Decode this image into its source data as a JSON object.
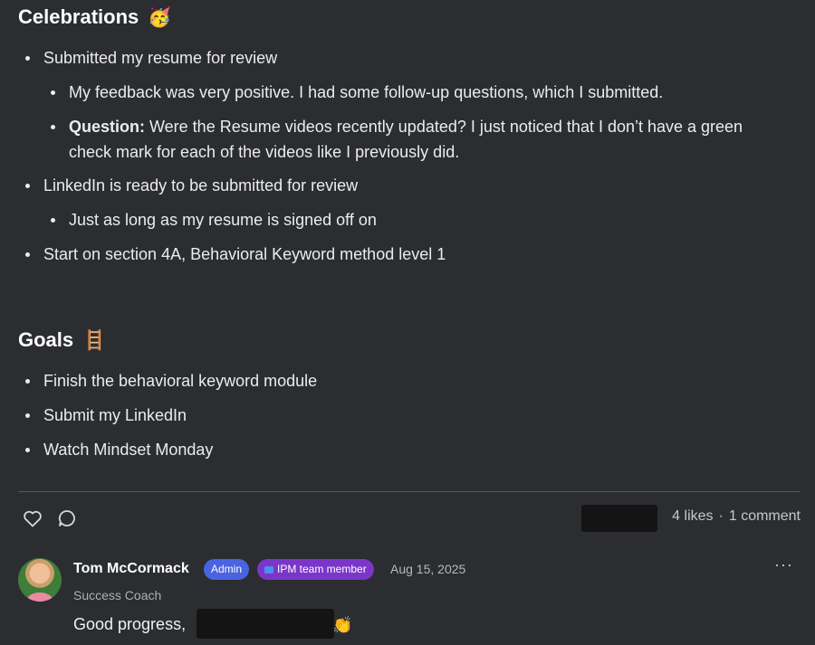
{
  "celebrations": {
    "heading": "Celebrations",
    "emoji": "🥳",
    "items": [
      {
        "text": "Submitted my resume for review"
      },
      {
        "text": "My feedback was very positive. I had some follow-up questions, which I submitted."
      },
      {
        "bold": "Question:",
        "text": " Were the Resume videos recently updated? I just noticed that I don’t have a green check mark for each of the videos like I previously did."
      },
      {
        "text": "LinkedIn is ready to be submitted for review"
      },
      {
        "text": "Just as long as my resume is signed off on"
      },
      {
        "text": "Start on section 4A, Behavioral Keyword method level 1"
      }
    ]
  },
  "goals": {
    "heading": "Goals",
    "emoji": "🪜",
    "items": [
      {
        "text": "Finish the behavioral keyword module"
      },
      {
        "text": "Submit my LinkedIn"
      },
      {
        "text": "Watch Mindset Monday"
      }
    ]
  },
  "post_actions": {
    "like_icon": "heart-icon",
    "comment_icon": "speech-bubble-icon",
    "likes": "4 likes",
    "separator": "·",
    "comments": "1 comment"
  },
  "comment": {
    "author": "Tom McCormack",
    "badge_admin": "Admin",
    "badge_team": "IPM team member",
    "date": "Aug 15, 2025",
    "role": "Success Coach",
    "text": "Good progress,",
    "emoji": "👏",
    "more_label": "···"
  },
  "colors": {
    "background": "#2b2d31",
    "admin_badge": "#4a63e0",
    "team_badge": "#7b36c9"
  }
}
